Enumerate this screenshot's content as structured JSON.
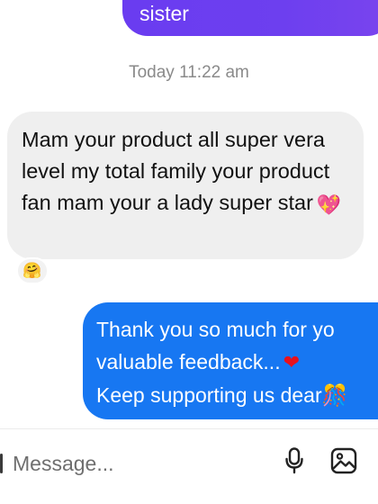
{
  "conversation": {
    "top_bubble_text": "sister",
    "timestamp": "Today 11:22 am",
    "incoming_message": "Mam your product all super vera level my total family your product fan mam your a lady super star",
    "incoming_emoji": "💖",
    "reaction_emoji": "🤗",
    "outgoing_lines": [
      "Thank you so much for yo",
      "valuable feedback...",
      "Keep supporting us dear"
    ],
    "outgoing_heart": "❤",
    "outgoing_trailing_emoji": "🎊"
  },
  "composer": {
    "placeholder": "Message..."
  },
  "icons": {
    "mic": "microphone-icon",
    "gallery": "image-gallery-icon"
  },
  "colors": {
    "top_bubble": "#6a3cf0",
    "incoming_bubble": "#efefef",
    "outgoing_bubble": "#1777f2",
    "timestamp_text": "#8a8a8a"
  }
}
